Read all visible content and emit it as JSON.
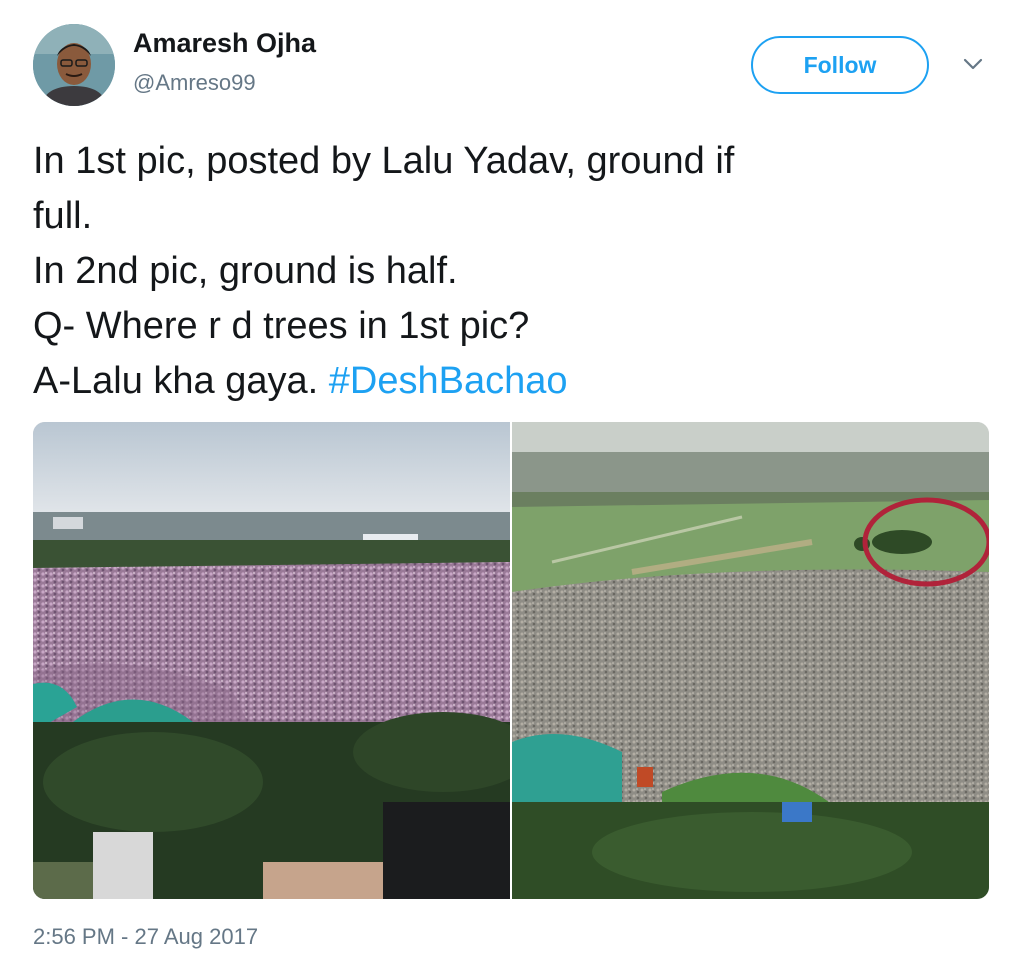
{
  "author": {
    "name": "Amaresh Ojha",
    "handle": "@Amreso99",
    "avatar_icon": "profile-photo"
  },
  "actions": {
    "follow_label": "Follow",
    "menu_icon": "chevron-down-icon"
  },
  "tweet": {
    "lines": [
      "In 1st pic, posted by Lalu Yadav, ground if",
      "full.",
      "In 2nd pic, ground is half.",
      "Q- Where r d trees in 1st pic?",
      "A-Lalu kha gaya. "
    ],
    "hashtag": "#DeshBachao"
  },
  "media": {
    "count": 2,
    "annotation": "red circle around trees"
  },
  "timestamp": "2:56 PM - 27 Aug 2017",
  "colors": {
    "accent": "#1da1f2",
    "text": "#14171a",
    "secondary": "#657786",
    "annotation": "#b0233a"
  }
}
